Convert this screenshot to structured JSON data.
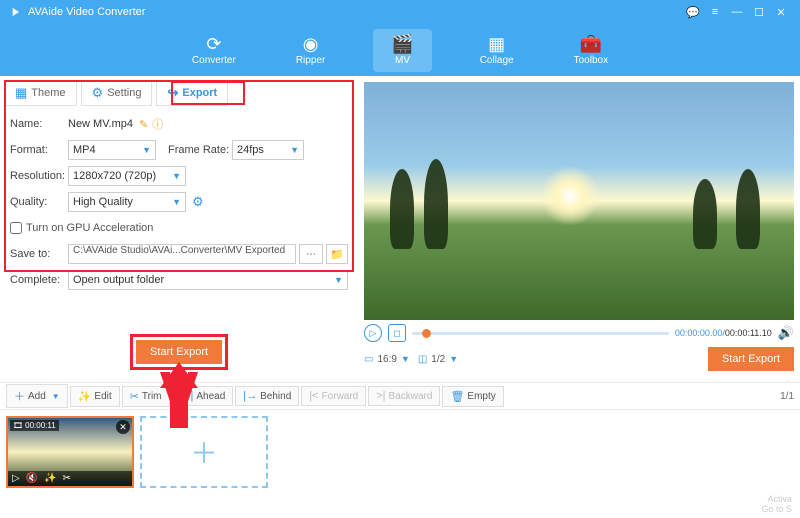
{
  "app": {
    "title": "AVAide Video Converter"
  },
  "nav": {
    "converter": "Converter",
    "ripper": "Ripper",
    "mv": "MV",
    "collage": "Collage",
    "toolbox": "Toolbox"
  },
  "tabs": {
    "theme": "Theme",
    "setting": "Setting",
    "export": "Export"
  },
  "form": {
    "name_label": "Name:",
    "name_value": "New MV.mp4",
    "format_label": "Format:",
    "format_value": "MP4",
    "framerate_label": "Frame Rate:",
    "framerate_value": "24fps",
    "resolution_label": "Resolution:",
    "resolution_value": "1280x720 (720p)",
    "quality_label": "Quality:",
    "quality_value": "High Quality",
    "gpu_label": "Turn on GPU Acceleration",
    "saveto_label": "Save to:",
    "saveto_value": "C:\\AVAide Studio\\AVAi...Converter\\MV Exported",
    "complete_label": "Complete:",
    "complete_value": "Open output folder"
  },
  "buttons": {
    "start_export": "Start Export"
  },
  "player": {
    "time_current": "00:00:00.00",
    "time_total": "00:00:11.10",
    "aspect": "16:9",
    "page": "1/2"
  },
  "toolbar": {
    "add": "Add",
    "edit": "Edit",
    "trim": "Trim",
    "ahead": "Ahead",
    "behind": "Behind",
    "forward": "Forward",
    "backward": "Backward",
    "empty": "Empty",
    "pager": "1/1"
  },
  "clip": {
    "duration": "00:00:11"
  },
  "watermark": {
    "l1": "Activa",
    "l2": "Go to S"
  }
}
